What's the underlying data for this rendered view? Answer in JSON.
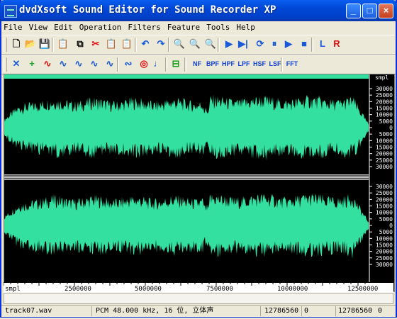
{
  "window": {
    "title": "dvdXsoft Sound Editor for Sound Recorder XP"
  },
  "title_buttons": [
    "_",
    "□",
    "×"
  ],
  "menu": [
    "File",
    "View",
    "Edit",
    "Operation",
    "Filters",
    "Feature",
    "Tools",
    "Help"
  ],
  "toolbar1": [
    {
      "name": "new-icon",
      "glyph": "🗋"
    },
    {
      "name": "open-icon",
      "glyph": "📂"
    },
    {
      "name": "save-icon",
      "glyph": "💾"
    },
    {
      "name": "properties-icon",
      "glyph": "📋"
    },
    {
      "name": "copy-icon",
      "glyph": "⧉"
    },
    {
      "name": "cut-icon",
      "glyph": "✂"
    },
    {
      "name": "paste-icon",
      "glyph": "📋"
    },
    {
      "name": "paste-mix-icon",
      "glyph": "📋"
    },
    {
      "name": "undo-icon",
      "glyph": "↶"
    },
    {
      "name": "redo-icon",
      "glyph": "↷"
    },
    {
      "name": "zoom-in-icon",
      "glyph": "🔍"
    },
    {
      "name": "zoom-out-icon",
      "glyph": "🔍"
    },
    {
      "name": "zoom-full-icon",
      "glyph": "🔍"
    },
    {
      "name": "play-icon",
      "glyph": "▶"
    },
    {
      "name": "play-to-end-icon",
      "glyph": "▶|"
    },
    {
      "name": "loop-play-icon",
      "glyph": "⟳"
    },
    {
      "name": "pause-icon",
      "glyph": "⏸"
    },
    {
      "name": "play-selection-icon",
      "glyph": "▶"
    },
    {
      "name": "stop-icon",
      "glyph": "■"
    },
    {
      "name": "left-channel-icon",
      "glyph": "L"
    },
    {
      "name": "right-channel-icon",
      "glyph": "R"
    }
  ],
  "toolbar2_icons": [
    {
      "name": "crossfade-icon",
      "glyph": "✕"
    },
    {
      "name": "insert-silence-icon",
      "glyph": "+"
    },
    {
      "name": "fade-in-icon",
      "glyph": "∿"
    },
    {
      "name": "fade-out-icon",
      "glyph": "∿"
    },
    {
      "name": "normalize-icon",
      "glyph": "∿"
    },
    {
      "name": "amplify-icon",
      "glyph": "∿"
    },
    {
      "name": "echo-icon",
      "glyph": "∿"
    },
    {
      "name": "reverse-icon",
      "glyph": "∾"
    },
    {
      "name": "reverb-icon",
      "glyph": "◎"
    },
    {
      "name": "pitch-icon",
      "glyph": "♩"
    },
    {
      "name": "trim-icon",
      "glyph": "⊟"
    }
  ],
  "filters": [
    "NF",
    "BPF",
    "HPF",
    "LPF",
    "HSF",
    "LSF",
    "FFT"
  ],
  "waveform": {
    "wave_color": "#33e0a0",
    "ruler_unit": "smpl",
    "amplitude_labels": [
      "30000",
      "25000",
      "20000",
      "15000",
      "10000",
      "5000",
      "0",
      "5000",
      "10000",
      "15000",
      "20000",
      "25000",
      "30000"
    ],
    "time_labels": [
      "smpl",
      "2500000",
      "5000000",
      "7500000",
      "10000000",
      "12500000"
    ]
  },
  "status": {
    "file": "track07.wav",
    "format": "PCM 48.000 kHz, 16 位, 立体声",
    "length": "12786560",
    "sel_start": "0",
    "sel_end": "12786560",
    "sel_len": "0"
  }
}
